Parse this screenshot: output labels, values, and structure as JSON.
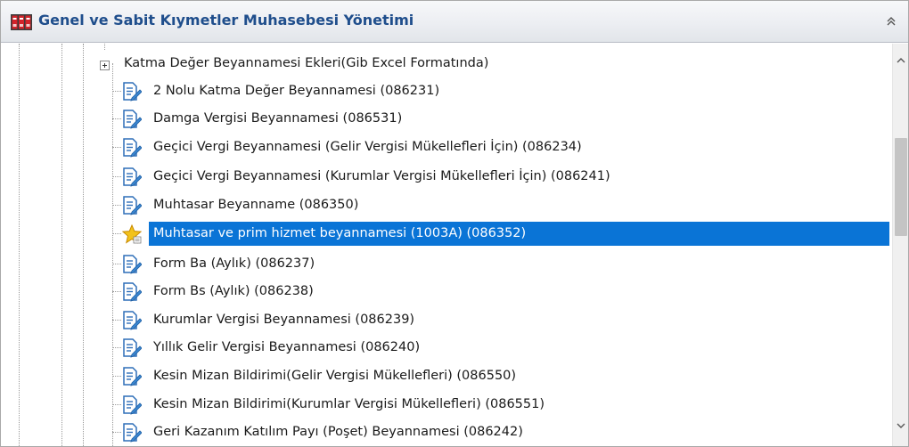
{
  "header": {
    "title": "Genel ve Sabit Kıymetler Muhasebesi Yönetimi",
    "app_icon": "binders-icon",
    "collapse_icon": "double-chevron-up-icon"
  },
  "tree": {
    "parent": {
      "label": "Katma Değer Beyannamesi Ekleri(Gib Excel Formatında)",
      "expanded": false
    },
    "items": [
      {
        "label": "2 Nolu Katma Değer Beyannamesi (086231)",
        "icon": "document-edit-icon",
        "selected": false
      },
      {
        "label": "Damga Vergisi Beyannamesi (086531)",
        "icon": "document-edit-icon",
        "selected": false
      },
      {
        "label": "Geçici Vergi Beyannamesi (Gelir Vergisi Mükellefleri İçin) (086234)",
        "icon": "document-edit-icon",
        "selected": false
      },
      {
        "label": "Geçici Vergi Beyannamesi (Kurumlar Vergisi Mükellefleri İçin) (086241)",
        "icon": "document-edit-icon",
        "selected": false
      },
      {
        "label": "Muhtasar Beyanname (086350)",
        "icon": "document-edit-icon",
        "selected": false
      },
      {
        "label": "Muhtasar ve prim hizmet beyannamesi (1003A) (086352)",
        "icon": "star-icon",
        "selected": true
      },
      {
        "label": "Form Ba (Aylık) (086237)",
        "icon": "document-edit-icon",
        "selected": false
      },
      {
        "label": "Form Bs (Aylık) (086238)",
        "icon": "document-edit-icon",
        "selected": false
      },
      {
        "label": "Kurumlar Vergisi Beyannamesi (086239)",
        "icon": "document-edit-icon",
        "selected": false
      },
      {
        "label": "Yıllık Gelir Vergisi Beyannamesi (086240)",
        "icon": "document-edit-icon",
        "selected": false
      },
      {
        "label": "Kesin Mizan Bildirimi(Gelir Vergisi Mükellefleri) (086550)",
        "icon": "document-edit-icon",
        "selected": false
      },
      {
        "label": "Kesin Mizan Bildirimi(Kurumlar Vergisi Mükellefleri) (086551)",
        "icon": "document-edit-icon",
        "selected": false
      },
      {
        "label": "Geri Kazanım Katılım Payı (Poşet) Beyannamesi (086242)",
        "icon": "document-edit-icon",
        "selected": false
      }
    ]
  },
  "colors": {
    "title": "#1f4e8c",
    "selection": "#0a74d6",
    "doc_icon": "#2f6fb8",
    "star": "#f2c21b"
  }
}
